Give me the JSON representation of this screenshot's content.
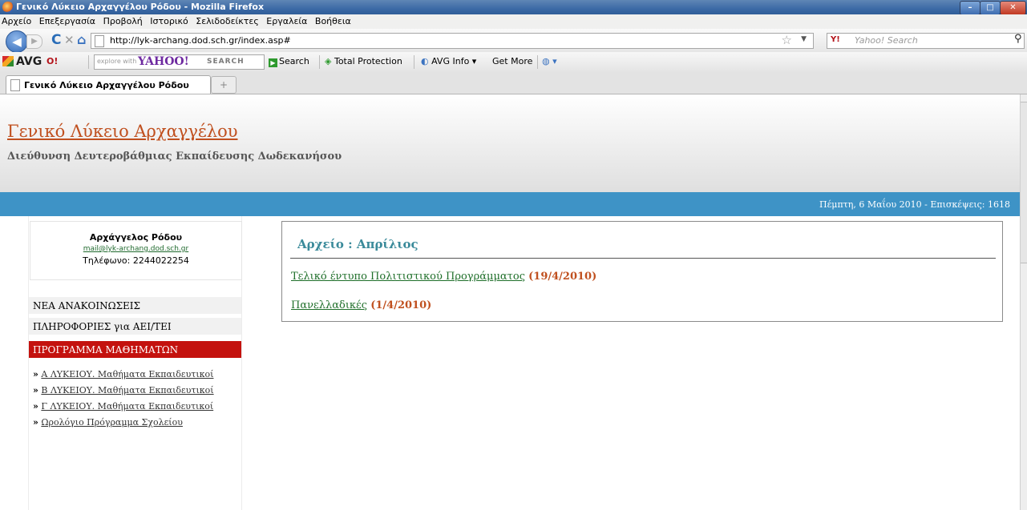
{
  "window": {
    "title": "Γενικό Λύκειο Αρχαγγέλου Ρόδου - Mozilla Firefox",
    "minimize": "–",
    "maximize": "□",
    "close": "✕"
  },
  "menu": {
    "items": [
      "Αρχείο",
      "Επεξεργασία",
      "Προβολή",
      "Ιστορικό",
      "Σελιδοδείκτες",
      "Εργαλεία",
      "Βοήθεια"
    ]
  },
  "nav": {
    "url": "http://lyk-archang.dod.sch.gr/index.asp#",
    "search_placeholder": "Yahoo! Search",
    "yahoo_icon": "Y!",
    "back_glyph": "◀",
    "forward_glyph": "▶",
    "reload_glyph": "C",
    "stop_glyph": "✕",
    "home_glyph": "⌂"
  },
  "toolbar": {
    "avg_label": "AVG",
    "yahoo_small": "O!",
    "explore_text": "explore with",
    "yahoo_brand": "YAHOO!",
    "search_text": "SEARCH",
    "search_button": "Search",
    "total_protection": "Total Protection",
    "avg_info": "AVG Info",
    "get_more": "Get More"
  },
  "tabs": [
    {
      "label": "Γενικό Λύκειο Αρχαγγέλου Ρόδου",
      "active": true
    }
  ],
  "site": {
    "title": "Γενικό Λύκειο Αρχαγγέλου",
    "subtitle": "Διεύθυνση Δευτεροβάθμιας Εκπαίδευσης Δωδεκανήσου",
    "date_visits": "Πέμπτη, 6 Μαΐου 2010   - Επισκέψεις: 1618"
  },
  "contact": {
    "name": "Αρχάγγελος Ρόδου",
    "email": "mail@lyk-archang.dod.sch.gr",
    "phone": "Τηλέφωνο: 2244022254"
  },
  "sidebar": {
    "items": [
      {
        "label": "ΝΕΑ ΑΝΑΚΟΙΝΩΣΕΙΣ",
        "active": false
      },
      {
        "label": "ΠΛΗΡΟΦΟΡΙΕΣ για ΑΕΙ/ΤΕΙ",
        "active": false
      },
      {
        "label": "ΠΡΟΓΡΑΜΜΑ ΜΑΘΗΜΑΤΩΝ",
        "active": true
      }
    ],
    "bullet": "»",
    "sublinks": [
      "Α ΛΥΚΕΙΟΥ. Μαθήματα Εκπαιδευτικοί",
      "Β ΛΥΚΕΙΟΥ. Μαθήματα Εκπαιδευτικοί",
      "Γ ΛΥΚΕΙΟΥ. Μαθήματα Εκπαιδευτικοί",
      "Ωρολόγιο Πρόγραμμα Σχολείου"
    ]
  },
  "content": {
    "heading": "Αρχείο : Απρίλιος",
    "entries": [
      {
        "title": "Τελικό έντυπο Πολιτιστικού Προγράμματος",
        "date": "(19/4/2010)"
      },
      {
        "title": "Πανελλαδικές",
        "date": "(1/4/2010)"
      }
    ]
  }
}
